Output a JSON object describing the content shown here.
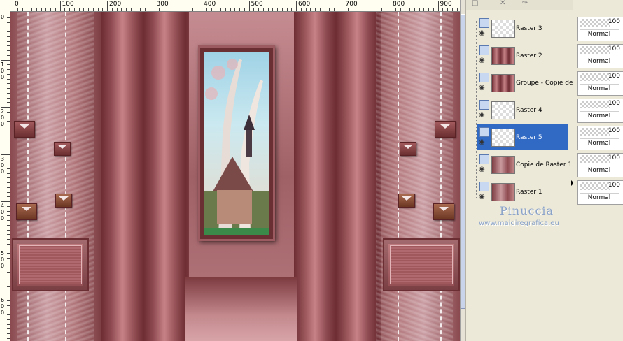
{
  "ruler": {
    "top_labels": [
      "0",
      "100",
      "200",
      "300",
      "400",
      "500",
      "600",
      "700",
      "800",
      "900"
    ],
    "left_labels": [
      "0",
      "1 0 0",
      "2 0 0",
      "3 0 0",
      "4 0 0",
      "5 0 0",
      "6 0 0"
    ]
  },
  "layers": {
    "items": [
      {
        "name": "Raster 3",
        "selected": false
      },
      {
        "name": "Raster 2",
        "selected": false
      },
      {
        "name": "Groupe - Copie de",
        "selected": false
      },
      {
        "name": "Raster 4",
        "selected": false
      },
      {
        "name": "Raster 5",
        "selected": true
      },
      {
        "name": "Copie de Raster 1",
        "selected": false
      },
      {
        "name": "Raster 1",
        "selected": false
      }
    ],
    "properties": [
      {
        "opacity": "100",
        "blend": "Normal"
      },
      {
        "opacity": "100",
        "blend": "Normal"
      },
      {
        "opacity": "100",
        "blend": "Normal"
      },
      {
        "opacity": "100",
        "blend": "Normal"
      },
      {
        "opacity": "100",
        "blend": "Normal"
      },
      {
        "opacity": "100",
        "blend": "Normal"
      },
      {
        "opacity": "100",
        "blend": "Normal"
      }
    ]
  },
  "watermark": {
    "name": "Pinuccia",
    "url": "www.maidiregrafica.eu"
  },
  "colors": {
    "selection": "#316ac5",
    "panel_bg": "#ece9d8",
    "art_base": "#b97b7e"
  },
  "icons": [
    "new-layer-icon",
    "delete-layer-icon",
    "eye-icon",
    "visibility-toggle-icon",
    "collapse-arrow-icon"
  ]
}
